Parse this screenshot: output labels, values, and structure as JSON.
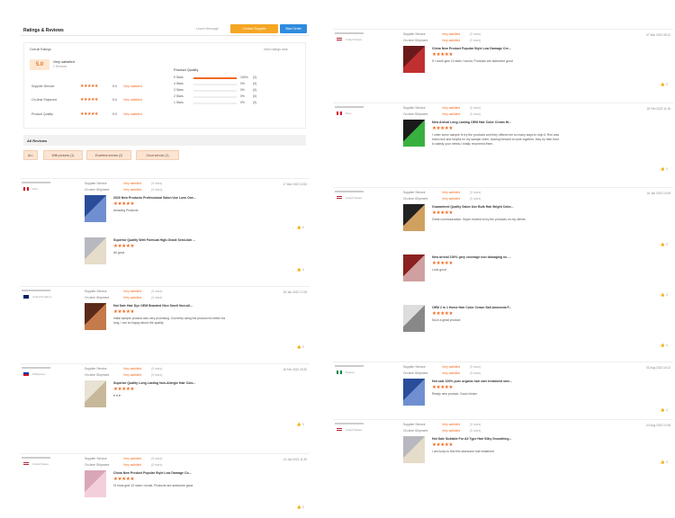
{
  "header": {
    "title": "Ratings & Reviews",
    "ghost_label": "Leave Message",
    "contact_label": "Contact Supplier",
    "order_label": "Start Order"
  },
  "overall": {
    "label": "Overall Ratings",
    "score": "5.0",
    "level": "Very satisfied",
    "reviews": "2 Reviews",
    "view_ratings": "View ratings rank",
    "services": [
      {
        "name": "Supplier Service",
        "stars": 5,
        "value": "5.0",
        "level": "Very satisfied"
      },
      {
        "name": "On-time Shipment",
        "stars": 5,
        "value": "5.0",
        "level": "Very satisfied"
      },
      {
        "name": "Product Quality",
        "stars": 5,
        "value": "5.0",
        "level": "Very satisfied"
      }
    ],
    "product_quality": {
      "title": "Product Quality",
      "rows": [
        {
          "stars": "5 Stars",
          "pct": "100%",
          "count": "(2)",
          "fill": 1.0
        },
        {
          "stars": "4 Stars",
          "pct": "0%",
          "count": "(0)",
          "fill": 0
        },
        {
          "stars": "3 Stars",
          "pct": "0%",
          "count": "(0)",
          "fill": 0
        },
        {
          "stars": "2 Stars",
          "pct": "0%",
          "count": "(0)",
          "fill": 0
        },
        {
          "stars": "1 Stars",
          "pct": "0%",
          "count": "(0)",
          "fill": 0
        }
      ]
    }
  },
  "all_reviews": {
    "label": "All Reviews",
    "chips": [
      "ALL",
      "With pictures (1)",
      "Excellent service (2)",
      "Good service (1)"
    ]
  },
  "review_labels": {
    "supplier_service": "Supplier Service",
    "on_time": "On-time Shipment",
    "very_satisfied": "Very satisfied",
    "five_stars": "(5 stars)",
    "like": "👍 0"
  },
  "reviews_left": [
    {
      "country": "Peru",
      "date": "17 Mar 2022 10:53",
      "products": [
        {
          "title": "2020 New Products Professional Salon Use Loss One...",
          "stars": "★★★★★",
          "comment": "Amazing Products"
        },
        {
          "title": "Superior Quality Wett Formula High-Grade Semi-hair ...",
          "stars": "★★★★★",
          "comment": "All good"
        }
      ]
    },
    {
      "country": "United Kingdom",
      "date": "25 Jan 2022 17:08",
      "products": [
        {
          "title": "Hot Sale Hair Dye OEM Branded Nice Smell Non-all...",
          "stars": "★★★★★",
          "comment": "Initial sample product was very promising. Currently using the product for better tra\nlong. I am so happy about the quality."
        }
      ]
    },
    {
      "country": "Philippines",
      "date": "16 Feb 2022 18:32",
      "products": [
        {
          "title": "Superior Quality Long Lasting Non-Allergic Hair Colo...",
          "stars": "★★★★★",
          "comment": "♥ ♥ ♥"
        }
      ]
    },
    {
      "country": "United States",
      "date": "14 Jan 2022 11:49",
      "products": [
        {
          "title": "China New Product Popular Style Low Damage Co...",
          "stars": "★★★★★",
          "comment": "I'll most give 10 stars I would. Products are awesome good"
        }
      ]
    }
  ],
  "reviews_right": [
    {
      "country": "United States",
      "date": "07 Mar 2022 09:12",
      "products": [
        {
          "title": "China New Product Popular Style Low Damage Cre...",
          "stars": "★★★★★",
          "comment": "If I could give 10 stars I would. Products are awesome good"
        }
      ]
    },
    {
      "country": "Peru",
      "date": "18 Feb 2022 11:26",
      "products": [
        {
          "title": "New Arrival Long Lasting OEM Hair Color Cream Hi...",
          "stars": "★★★★★",
          "comment": "I order some sample fo try the products and they offered me so many ways to ship it. Ren was\nextra nice and helpful on my sample order, looking forward to work together. they try their best\nto satisfy your needs.I totally recomend them."
        }
      ]
    },
    {
      "country": "United States",
      "date": "16 Jan 2022 13:08",
      "products": [
        {
          "title": "Guaranteed Quality Salon Use Bulk Hair Bright Color...",
          "stars": "★★★★★",
          "comment": "Great communication. Super excited to try the products on my clients"
        },
        {
          "title": "New arrival 100% grey coverage non damaging no ...",
          "stars": "★★★★★",
          "comment": "Look good"
        },
        {
          "title": "OEM 2 in 1 Home Hair Color Cream Salt Ammonia F...",
          "stars": "★★★★★",
          "comment": "Such a great product"
        }
      ]
    },
    {
      "country": "Nigeria",
      "date": "03 Aug 2022 16:12",
      "products": [
        {
          "title": "Hot sale 100% pure organic hair care treatment sme...",
          "stars": "★★★★★",
          "comment": "Ready new product. Good choice"
        }
      ]
    },
    {
      "country": "United States",
      "date": "03 Aug 2022 10:38",
      "products": [
        {
          "title": "Hot Sale Suitable For All Type Hair Silky Smoothing...",
          "stars": "★★★★★",
          "comment": "I am lucky to find this awesome hair treatment"
        }
      ]
    }
  ],
  "colors": {
    "accent": "#f26b22",
    "button_orange": "#f5a623",
    "button_blue": "#2f8bde",
    "score_bg": "#fde7d1",
    "chip_bg": "#fbe4d2"
  }
}
